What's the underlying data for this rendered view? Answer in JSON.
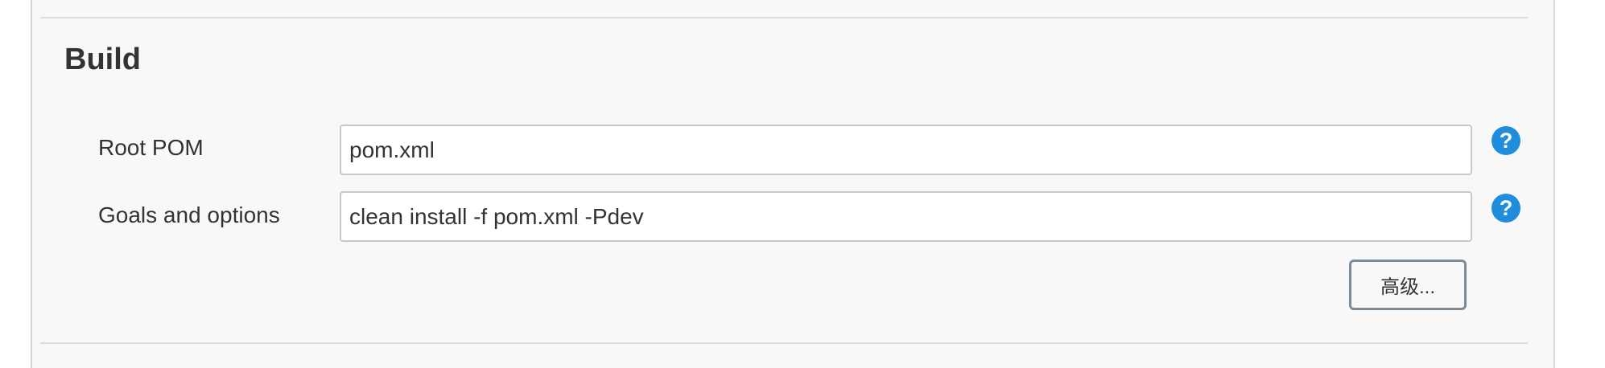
{
  "section": {
    "title": "Build"
  },
  "fields": {
    "root_pom": {
      "label": "Root POM",
      "value": "pom.xml",
      "help_icon": "?"
    },
    "goals": {
      "label": "Goals and options",
      "value": "clean install -f pom.xml -Pdev",
      "help_icon": "?"
    }
  },
  "advanced_button": {
    "label": "高级..."
  },
  "colors": {
    "help_icon": "#1f8ddb",
    "panel_background": "#f8f8f8",
    "text": "#333333"
  },
  "icons": {
    "help": "question-circle-icon"
  }
}
